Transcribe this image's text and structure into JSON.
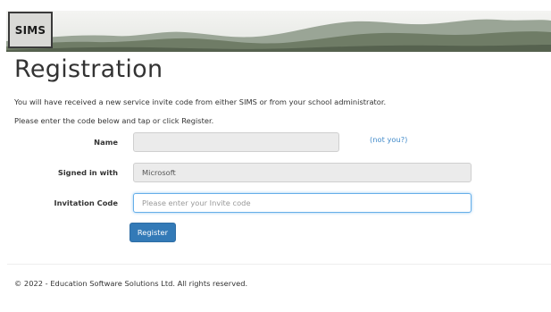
{
  "header": {
    "logo_text": "SIMS",
    "banner_image": "mountain-landscape"
  },
  "page": {
    "title": "Registration",
    "intro_line1": "You will have received a new service invite code from either SIMS or from your school administrator.",
    "intro_line2": "Please enter the code below and tap or click Register."
  },
  "form": {
    "name_label": "Name",
    "name_value": "",
    "not_you_link": "(not you?)",
    "signed_in_label": "Signed in with",
    "signed_in_value": "Microsoft",
    "invite_label": "Invitation Code",
    "invite_placeholder": "Please enter your Invite code",
    "register_button": "Register"
  },
  "footer": {
    "copyright": "© 2022 - Education Software Solutions Ltd. All rights reserved."
  },
  "colors": {
    "primary_button": "#337ab7",
    "link": "#428bca",
    "focus_border": "#66afe9",
    "disabled_field": "#ebebeb"
  }
}
